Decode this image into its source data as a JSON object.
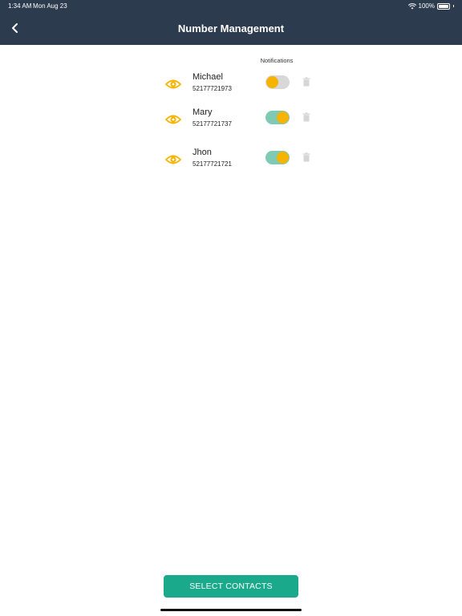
{
  "status_bar": {
    "time": "1:34 AM",
    "date": "Mon Aug 23",
    "battery": "100%"
  },
  "header": {
    "title": "Number Management"
  },
  "list": {
    "notifications_label": "Notifications",
    "contacts": [
      {
        "name": "Michael",
        "phone": "52177721973",
        "notifications": "off"
      },
      {
        "name": "Mary",
        "phone": "52177721737",
        "notifications": "on"
      },
      {
        "name": "Jhon",
        "phone": "52177721721",
        "notifications": "on"
      }
    ]
  },
  "footer": {
    "select_contacts_label": "SELECT CONTACTS"
  },
  "colors": {
    "header_bg": "#2d3b4e",
    "accent": "#f6b400",
    "toggle_on": "#7fcab4",
    "button": "#1aa98a"
  }
}
